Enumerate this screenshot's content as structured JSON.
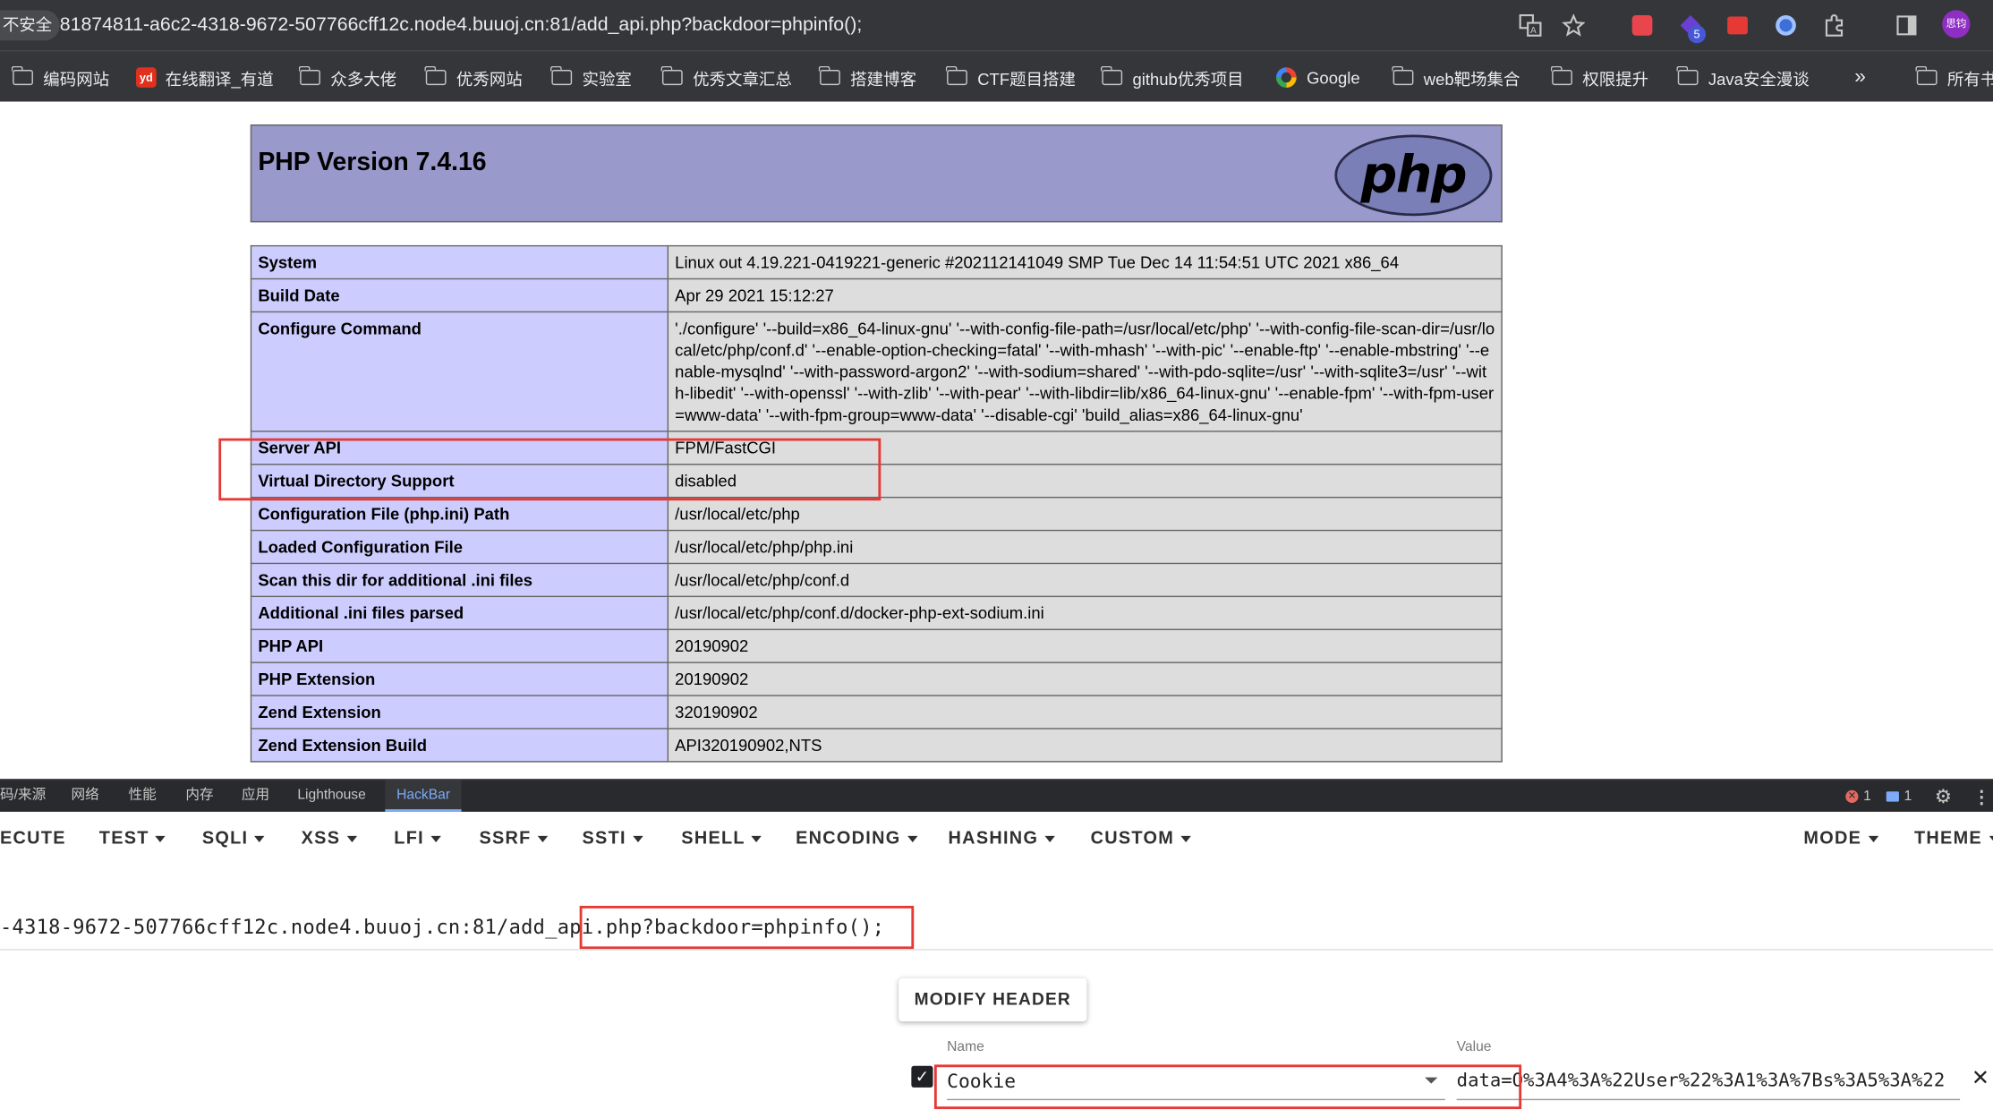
{
  "browser": {
    "security_label": "不安全",
    "url": "81874811-a6c2-4318-9672-507766cff12c.node4.buuoj.cn:81/add_api.php?backdoor=phpinfo();",
    "extension_badge": "5",
    "profile_initials": "思钧",
    "icons": [
      "translate-icon",
      "star-icon",
      "extension-icon",
      "extension-icon",
      "extension-icon",
      "extension-icon",
      "puzzle-icon",
      "side-panel-icon",
      "avatar"
    ],
    "bookmarks": [
      {
        "label": "编码网站",
        "icon": "folder-icon"
      },
      {
        "label": "在线翻译_有道",
        "icon": "youdao-icon"
      },
      {
        "label": "众多大佬",
        "icon": "folder-icon"
      },
      {
        "label": "优秀网站",
        "icon": "folder-icon"
      },
      {
        "label": "实验室",
        "icon": "folder-icon"
      },
      {
        "label": "优秀文章汇总",
        "icon": "folder-icon"
      },
      {
        "label": "搭建博客",
        "icon": "folder-icon"
      },
      {
        "label": "CTF题目搭建",
        "icon": "folder-icon"
      },
      {
        "label": "github优秀项目",
        "icon": "folder-icon"
      },
      {
        "label": "Google",
        "icon": "google-icon"
      },
      {
        "label": "web靶场集合",
        "icon": "folder-icon"
      },
      {
        "label": "权限提升",
        "icon": "folder-icon"
      },
      {
        "label": "Java安全漫谈",
        "icon": "folder-icon"
      }
    ],
    "more_bookmarks": "»",
    "all_bookmarks": "所有书"
  },
  "phpinfo": {
    "title": "PHP Version 7.4.16",
    "logo_text": "php",
    "rows": [
      {
        "key": "System",
        "value": "Linux out 4.19.221-0419221-generic #202112141049 SMP Tue Dec 14 11:54:51 UTC 2021 x86_64"
      },
      {
        "key": "Build Date",
        "value": "Apr 29 2021 15:12:27"
      },
      {
        "key": "Configure Command",
        "value": "'./configure' '--build=x86_64-linux-gnu' '--with-config-file-path=/usr/local/etc/php' '--with-config-file-scan-dir=/usr/local/etc/php/conf.d' '--enable-option-checking=fatal' '--with-mhash' '--with-pic' '--enable-ftp' '--enable-mbstring' '--enable-mysqlnd' '--with-password-argon2' '--with-sodium=shared' '--with-pdo-sqlite=/usr' '--with-sqlite3=/usr' '--with-libedit' '--with-openssl' '--with-zlib' '--with-pear' '--with-libdir=lib/x86_64-linux-gnu' '--enable-fpm' '--with-fpm-user=www-data' '--with-fpm-group=www-data' '--disable-cgi' 'build_alias=x86_64-linux-gnu'"
      },
      {
        "key": "Server API",
        "value": "FPM/FastCGI"
      },
      {
        "key": "Virtual Directory Support",
        "value": "disabled"
      },
      {
        "key": "Configuration File (php.ini) Path",
        "value": "/usr/local/etc/php"
      },
      {
        "key": "Loaded Configuration File",
        "value": "/usr/local/etc/php/php.ini"
      },
      {
        "key": "Scan this dir for additional .ini files",
        "value": "/usr/local/etc/php/conf.d"
      },
      {
        "key": "Additional .ini files parsed",
        "value": "/usr/local/etc/php/conf.d/docker-php-ext-sodium.ini"
      },
      {
        "key": "PHP API",
        "value": "20190902"
      },
      {
        "key": "PHP Extension",
        "value": "20190902"
      },
      {
        "key": "Zend Extension",
        "value": "320190902"
      },
      {
        "key": "Zend Extension Build",
        "value": "API320190902,NTS"
      }
    ]
  },
  "devtools": {
    "tabs": [
      "码/来源",
      "网络",
      "性能",
      "内存",
      "应用",
      "Lighthouse",
      "HackBar"
    ],
    "active_tab": "HackBar",
    "error_count": "1",
    "message_count": "1"
  },
  "hackbar": {
    "menu": [
      "ECUTE",
      "TEST",
      "SQLI",
      "XSS",
      "LFI",
      "SSRF",
      "SSTI",
      "SHELL",
      "ENCODING",
      "HASHING",
      "CUSTOM",
      "MODE",
      "THEME"
    ],
    "url_value": "-4318-9672-507766cff12c.node4.buuoj.cn:81/add_api.php?backdoor=phpinfo();",
    "modify_header_label": "MODIFY HEADER",
    "header": {
      "name_label": "Name",
      "value_label": "Value",
      "name": "Cookie",
      "value": "data=O%3A4%3A%22User%22%3A1%3A%7Bs%3A5%3A%22",
      "enabled": true
    }
  }
}
